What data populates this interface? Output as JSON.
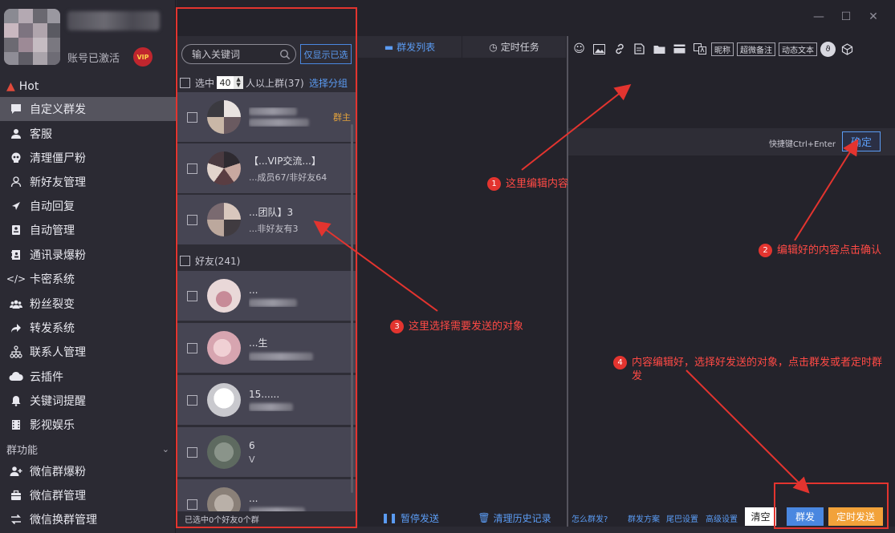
{
  "profile": {
    "status": "账号已激活",
    "vip": "VIP"
  },
  "sidebar": {
    "hot": "Hot",
    "items": [
      {
        "label": "自定义群发",
        "icon": "chat-bubble-icon"
      },
      {
        "label": "客服",
        "icon": "user-icon"
      },
      {
        "label": "清理僵尸粉",
        "icon": "skull-icon"
      },
      {
        "label": "新好友管理",
        "icon": "person-outline-icon"
      },
      {
        "label": "自动回复",
        "icon": "send-arrow-icon"
      },
      {
        "label": "自动管理",
        "icon": "id-card-icon"
      },
      {
        "label": "通讯录爆粉",
        "icon": "address-book-icon"
      },
      {
        "label": "卡密系统",
        "icon": "code-icon"
      },
      {
        "label": "粉丝裂变",
        "icon": "fans-icon"
      },
      {
        "label": "转发系统",
        "icon": "share-icon"
      },
      {
        "label": "联系人管理",
        "icon": "org-chart-icon"
      },
      {
        "label": "云插件",
        "icon": "cloud-icon"
      },
      {
        "label": "关键词提醒",
        "icon": "bell-icon"
      },
      {
        "label": "影视娱乐",
        "icon": "film-icon"
      }
    ],
    "group_section": "群功能",
    "group_items": [
      {
        "label": "微信群爆粉",
        "icon": "add-user-icon"
      },
      {
        "label": "微信群管理",
        "icon": "briefcase-icon"
      },
      {
        "label": "微信换群管理",
        "icon": "swap-icon"
      }
    ]
  },
  "contacts": {
    "search_placeholder": "输入关键词",
    "only_selected": "仅显示已选",
    "groups_header": {
      "select": "选中",
      "count": "40",
      "suffix": "人以上群(37)",
      "choose_group": "选择分组"
    },
    "groups": [
      {
        "name": "",
        "sub": "",
        "tag": "群主"
      },
      {
        "name": "【...VIP交流...】",
        "sub": "...成员67/非好友64",
        "tag": ""
      },
      {
        "name": "...团队】3",
        "sub": "...非好友有3",
        "tag": ""
      }
    ],
    "friends_header": "好友(241)",
    "friends": [
      {
        "name": "...",
        "sub": ""
      },
      {
        "name": "...生",
        "sub": ""
      },
      {
        "name": "1​5......",
        "sub": ""
      },
      {
        "name": "6",
        "sub": "V"
      },
      {
        "name": "...",
        "sub": ""
      }
    ],
    "footer": "已选中0个好友0个群"
  },
  "middle": {
    "tabs": [
      {
        "label": "群发列表",
        "active": true
      },
      {
        "label": "定时任务",
        "active": false
      }
    ],
    "pause": "暂停发送",
    "clear_history": "清理历史记录"
  },
  "editor": {
    "toolbar_text_buttons": [
      "昵称",
      "超微备注",
      "动态文本"
    ],
    "shortcut": "快捷键Ctrl+Enter",
    "confirm": "确定",
    "footer_links": [
      "怎么群发?",
      "群发方案",
      "尾巴设置",
      "高级设置"
    ],
    "clear": "清空",
    "mass_send": "群发",
    "scheduled_send": "定时发送"
  },
  "annotations": [
    {
      "num": "1",
      "text": "这里编辑内容"
    },
    {
      "num": "2",
      "text": "编辑好的内容点击确认"
    },
    {
      "num": "3",
      "text": "这里选择需要发送的对象"
    },
    {
      "num": "4",
      "text": "内容编辑好，选择好发送的对象，点击群发或者定时群发"
    }
  ],
  "colors": {
    "accent": "#5b9cf4",
    "annotation": "#e3342f",
    "scheduled": "#f2a23a",
    "send": "#4a87e0"
  }
}
